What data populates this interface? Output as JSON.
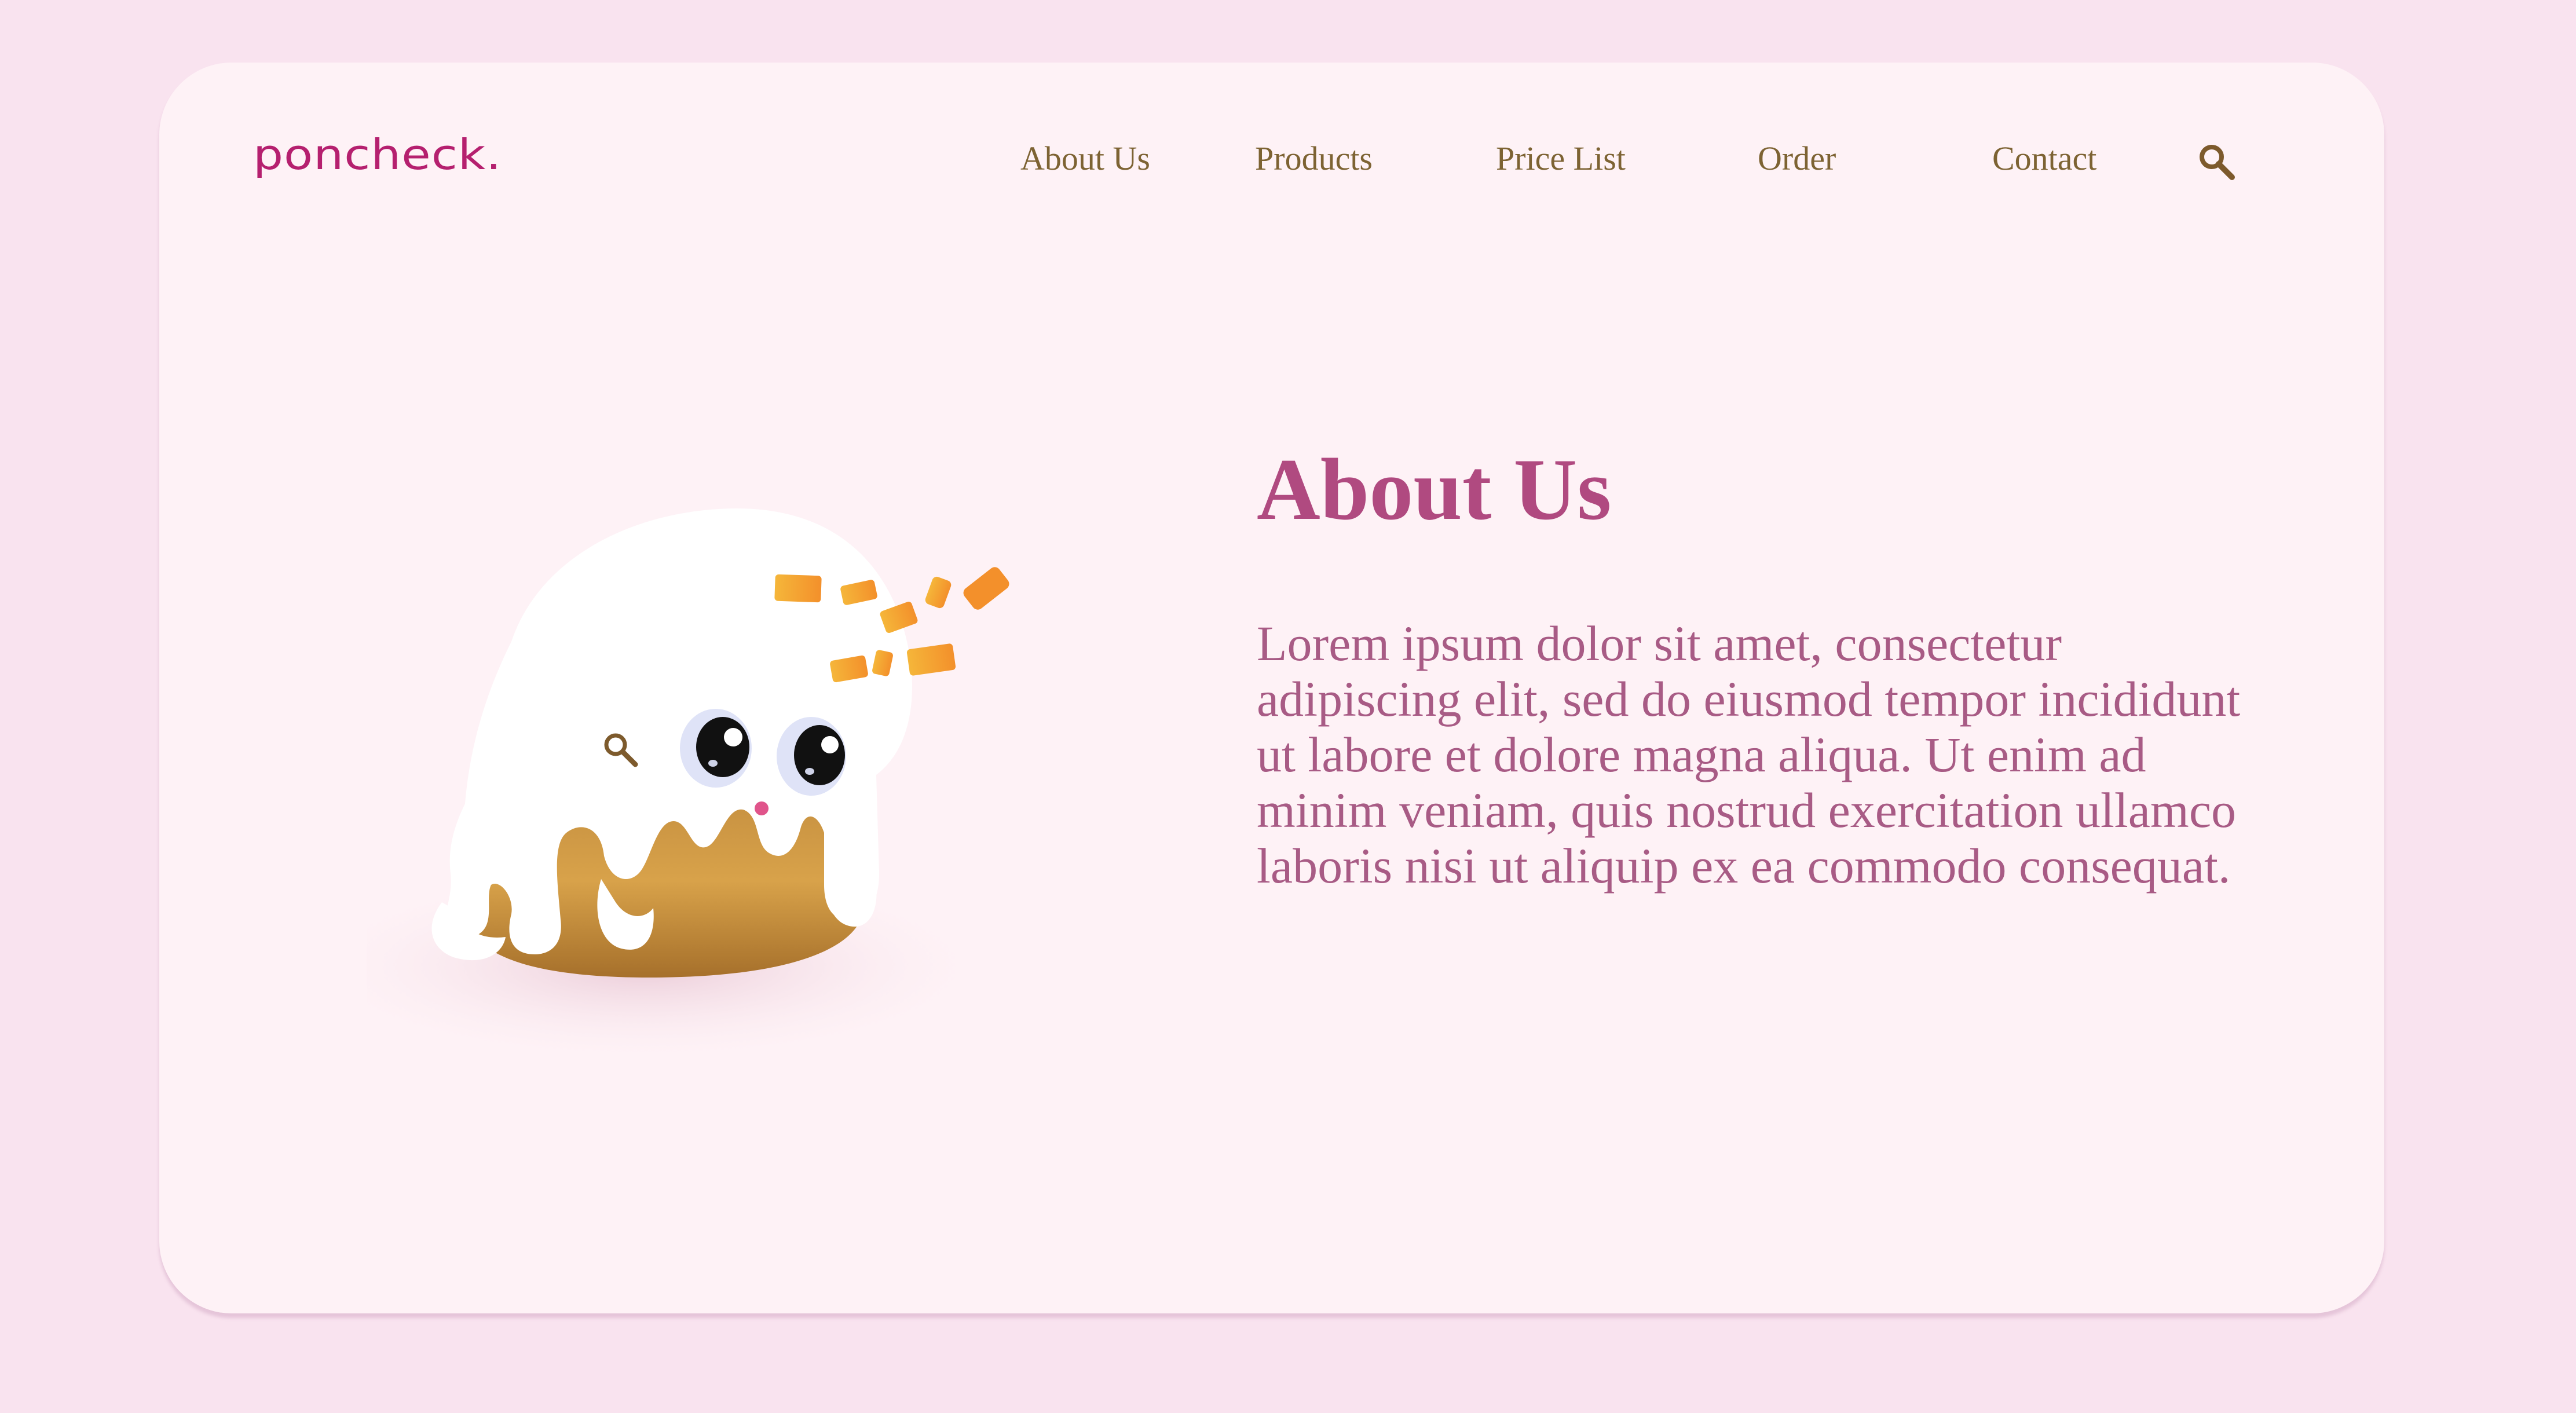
{
  "brand": {
    "logo_text": "poncheck."
  },
  "nav": {
    "items": [
      {
        "label": "About Us"
      },
      {
        "label": "Products"
      },
      {
        "label": "Price List"
      },
      {
        "label": "Order"
      },
      {
        "label": "Contact"
      }
    ],
    "search_icon": "search-icon"
  },
  "hero": {
    "image": "donut-mascot-illustration",
    "title": "About Us",
    "body": "Lorem ipsum dolor sit amet, consectetur adipiscing elit, sed do eiusmod tempor incididunt ut labore et dolore magna aliqua. Ut enim ad minim veniam, quis nostrud exercitation ullamco laboris nisi ut aliquip ex ea commodo consequat."
  },
  "colors": {
    "page_bg": "#f9e3ef",
    "card_bg": "#fef2f6",
    "brand": "#b5206f",
    "nav_text": "#7d6333",
    "heading": "#b04a80",
    "body_text": "#a85b85"
  }
}
